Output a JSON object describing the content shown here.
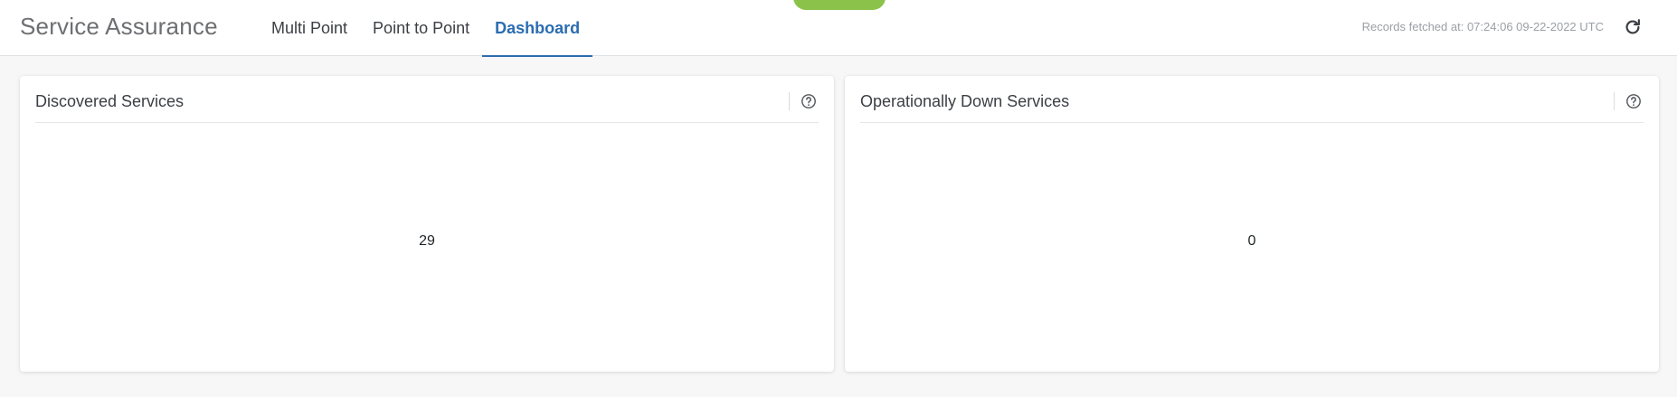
{
  "header": {
    "app_title": "Service Assurance",
    "tabs": [
      {
        "label": "Multi Point",
        "active": false
      },
      {
        "label": "Point to Point",
        "active": false
      },
      {
        "label": "Dashboard",
        "active": true
      }
    ],
    "records_fetched": "Records fetched at: 07:24:06 09-22-2022 UTC",
    "refresh_icon": "refresh-icon"
  },
  "cards": [
    {
      "title": "Discovered Services",
      "value": "29",
      "help_icon": "help-circle-icon"
    },
    {
      "title": "Operationally Down Services",
      "value": "0",
      "help_icon": "help-circle-icon"
    }
  ],
  "colors": {
    "accent": "#2b6cb0",
    "banner_green": "#8bc34a",
    "background": "#f7f7f8"
  }
}
